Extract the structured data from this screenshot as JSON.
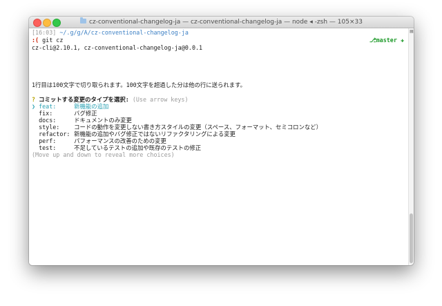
{
  "window": {
    "title": "cz-conventional-changelog-ja — cz-conventional-changelog-ja — node ◂ -zsh — 105×33"
  },
  "prompt": {
    "time": "[16:03]",
    "path": "~/.g/g/A/cz-conventional-changelog-ja",
    "face": ":(",
    "command": "git cz",
    "branch": "master",
    "branch_status": "✚"
  },
  "output": {
    "version_line": "cz-cli@2.10.1, cz-conventional-changelog-ja@0.0.1",
    "notice_line": "1行目は100文字で切り取られます。100文字を超過した分は他の行に送られます。",
    "question_mark": "?",
    "question": "コミットする変更のタイプを選択:",
    "hint": "(Use arrow keys)",
    "pointer": "❯",
    "more_hint": "(Move up and down to reveal more choices)"
  },
  "choices": [
    {
      "key": "feat:",
      "desc": "新機能の追加",
      "selected": true
    },
    {
      "key": "fix:",
      "desc": "バグ修正",
      "selected": false
    },
    {
      "key": "docs:",
      "desc": "ドキュメントのみ変更",
      "selected": false
    },
    {
      "key": "style:",
      "desc": "コードの動作を変更しない書き方スタイルの変更（スペース、フォーマット、セミコロンなど）",
      "selected": false
    },
    {
      "key": "refactor:",
      "desc": "新機能の追加やバグ修正ではないリファクタリングによる変更",
      "selected": false
    },
    {
      "key": "perf:",
      "desc": "パフォーマンスの改善のための変更",
      "selected": false
    },
    {
      "key": "test:",
      "desc": "不足しているテストの追加や既存のテストの修正",
      "selected": false
    }
  ],
  "colors": {
    "path": "#3b7fc4",
    "selected": "#2aa1b3",
    "branch": "#1e9a2a",
    "error_face": "#c91b00"
  }
}
